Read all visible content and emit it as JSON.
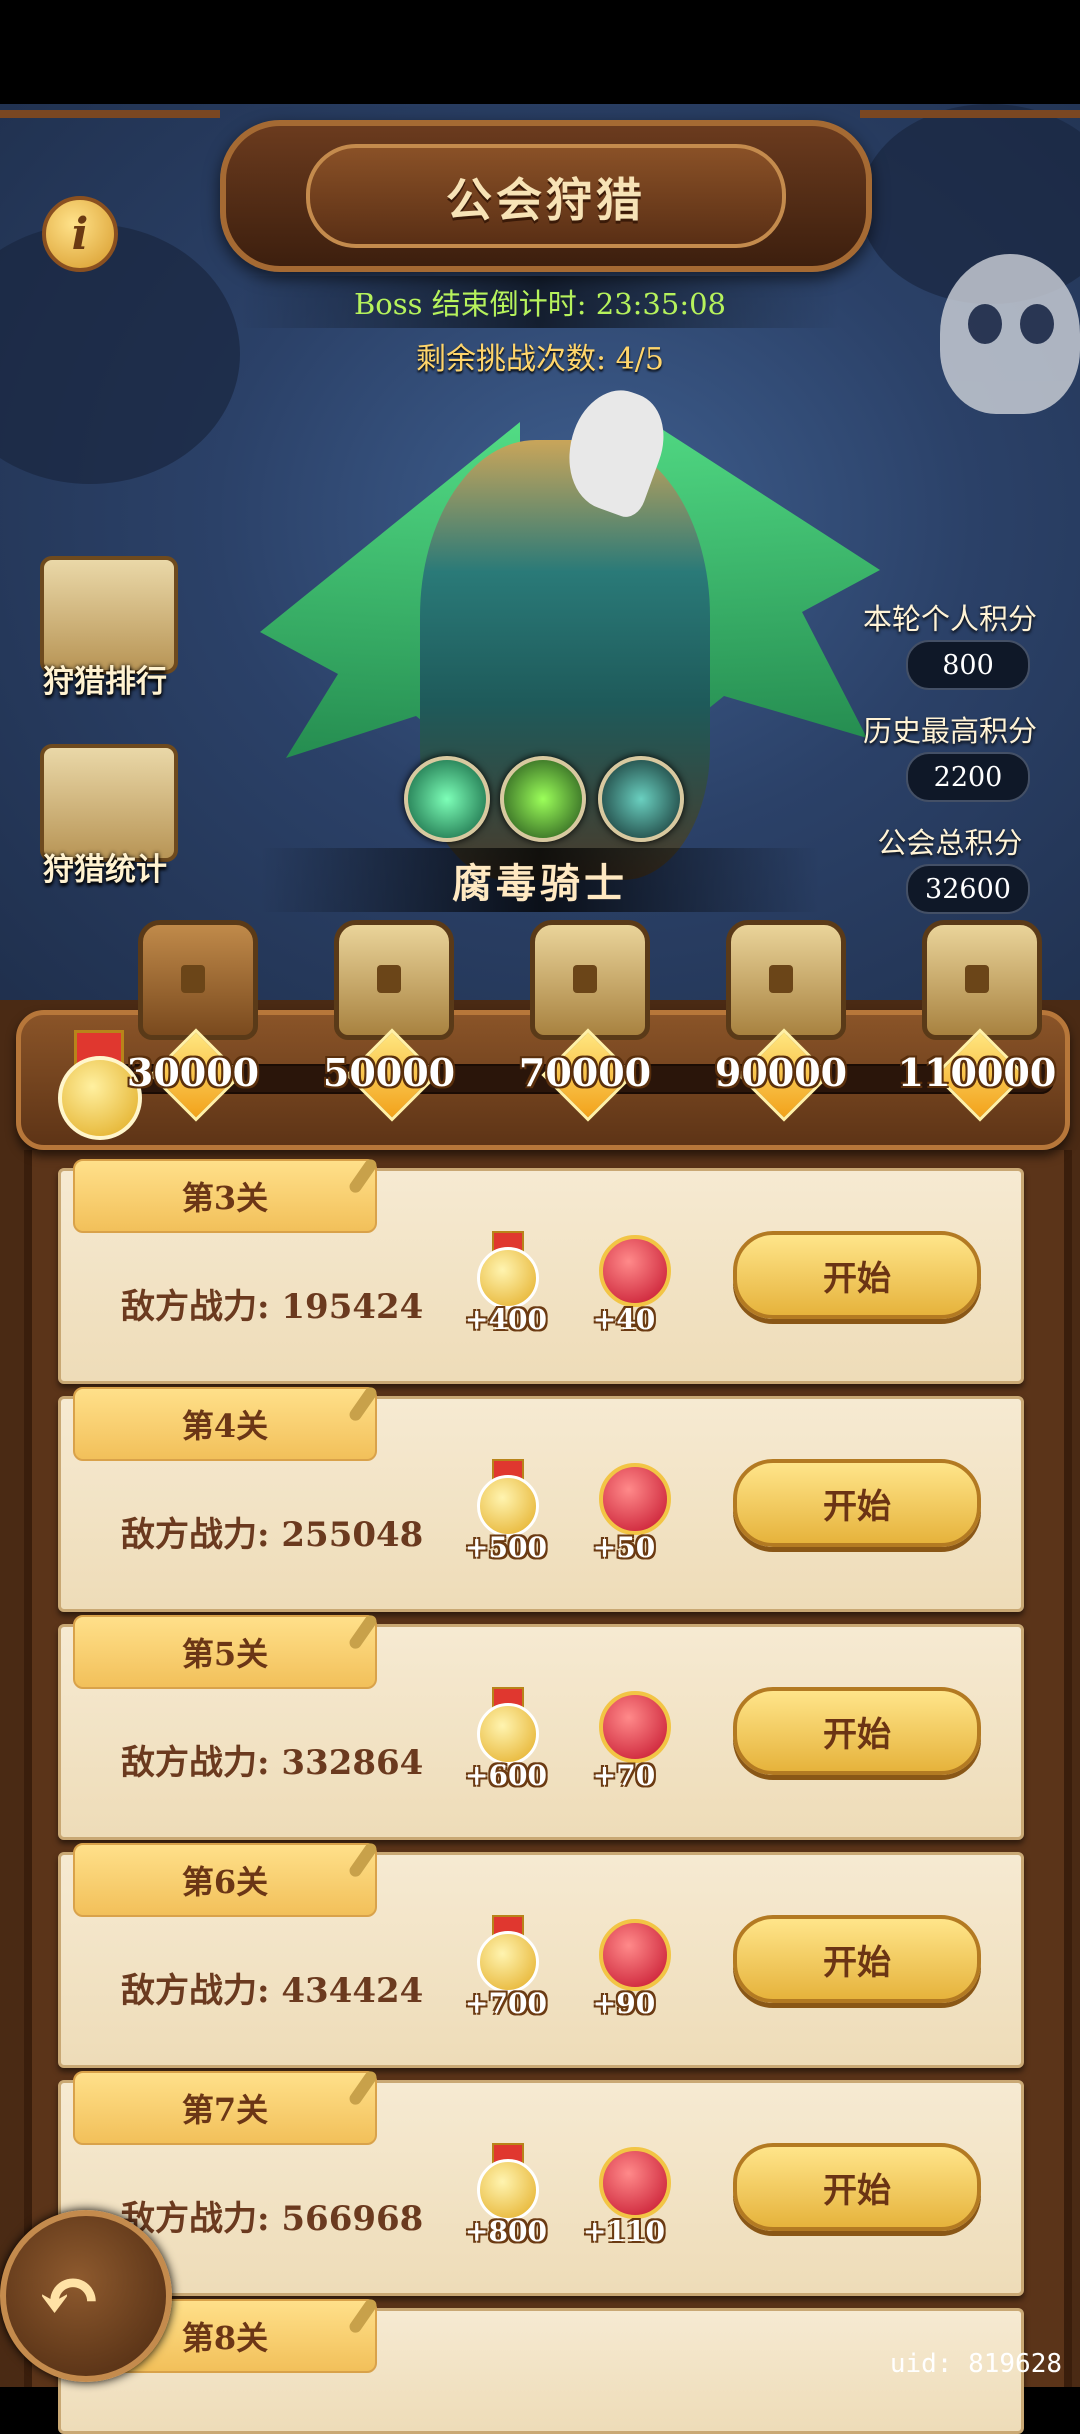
{
  "header": {
    "title": "公会狩猎",
    "info_icon": "i",
    "countdown": "Boss 结束倒计时: 23:35:08",
    "attempts": "剩余挑战次数: 4/5"
  },
  "boss": {
    "name": "腐毒骑士"
  },
  "side_menu": [
    {
      "label": "狩猎排行",
      "icon": "podium-icon"
    },
    {
      "label": "狩猎统计",
      "icon": "crossed-swords-icon"
    }
  ],
  "stats": [
    {
      "label": "本轮个人积分",
      "value": "800"
    },
    {
      "label": "历史最高积分",
      "value": "2200"
    },
    {
      "label": "公会总积分",
      "value": "32600"
    }
  ],
  "milestones": [
    "30000",
    "50000",
    "70000",
    "90000",
    "110000"
  ],
  "stages": [
    {
      "tab": "第3关",
      "power": "敌方战力: 195424",
      "medal": "+400",
      "ruby": "+40",
      "button": "开始"
    },
    {
      "tab": "第4关",
      "power": "敌方战力: 255048",
      "medal": "+500",
      "ruby": "+50",
      "button": "开始"
    },
    {
      "tab": "第5关",
      "power": "敌方战力: 332864",
      "medal": "+600",
      "ruby": "+70",
      "button": "开始"
    },
    {
      "tab": "第6关",
      "power": "敌方战力: 434424",
      "medal": "+700",
      "ruby": "+90",
      "button": "开始"
    },
    {
      "tab": "第7关",
      "power": "敌方战力: 566968",
      "medal": "+800",
      "ruby": "+110",
      "button": "开始"
    },
    {
      "tab": "第8关"
    }
  ],
  "footer": {
    "uid": "uid: 819628"
  },
  "colors": {
    "accent_gold": "#f2c05a",
    "countdown_green": "#b6f25c",
    "wood": "#5b3419"
  }
}
